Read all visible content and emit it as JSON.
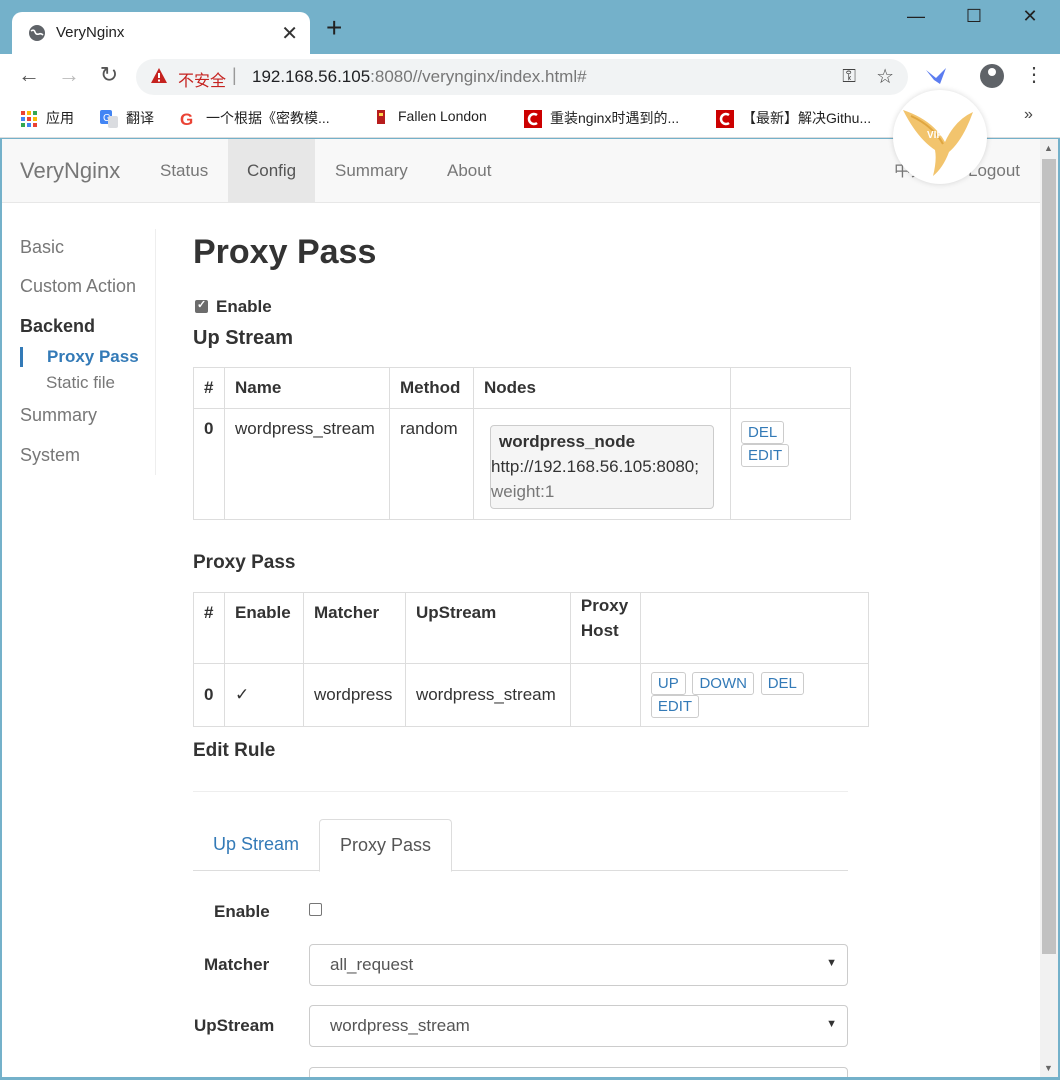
{
  "browser": {
    "tab_title": "VeryNginx",
    "new_tab": "+",
    "insecure_label": "不安全",
    "url_host": "192.168.56.105",
    "url_rest": ":8080//verynginx/index.html#",
    "bookmarks": [
      {
        "label": "应用",
        "icon": "apps-grid-icon"
      },
      {
        "label": "翻译",
        "icon": "translate-icon"
      },
      {
        "label": "一个根据《密教模...",
        "icon": "google-icon"
      },
      {
        "label": "Fallen London",
        "icon": "fallen-london-icon"
      },
      {
        "label": "重装nginx时遇到的...",
        "icon": "csdn-icon"
      },
      {
        "label": "【最新】解决Githu...",
        "icon": "csdn-icon"
      }
    ],
    "more": "»"
  },
  "navbar": {
    "brand": "VeryNginx",
    "links": [
      "Status",
      "Config",
      "Summary",
      "About"
    ],
    "active": "Config",
    "lang": "中文",
    "logout": "Logout"
  },
  "sidebar": {
    "items": [
      "Basic",
      "Custom Action",
      "Backend",
      "Summary",
      "System"
    ],
    "sub": [
      "Proxy Pass",
      "Static file"
    ]
  },
  "main": {
    "title": "Proxy Pass",
    "enable_label": "Enable",
    "upstream_heading": "Up Stream",
    "upstream_table": {
      "headers": [
        "#",
        "Name",
        "Method",
        "Nodes",
        ""
      ],
      "rows": [
        {
          "index": "0",
          "name": "wordpress_stream",
          "method": "random",
          "node_name": "wordpress_node",
          "node_url": "http://192.168.56.105:8080;",
          "node_weight": "weight:1",
          "actions": [
            "DEL",
            "EDIT"
          ]
        }
      ]
    },
    "proxypass_heading": "Proxy Pass",
    "proxypass_table": {
      "headers": [
        "#",
        "Enable",
        "Matcher",
        "UpStream",
        "Proxy Host",
        ""
      ],
      "rows": [
        {
          "index": "0",
          "enable": "✓",
          "matcher": "wordpress",
          "upstream": "wordpress_stream",
          "proxy_host": "",
          "actions": [
            "UP",
            "DOWN",
            "DEL",
            "EDIT"
          ]
        }
      ]
    },
    "edit_heading": "Edit Rule",
    "tabs": [
      "Up Stream",
      "Proxy Pass"
    ],
    "active_tab": "Proxy Pass",
    "form": {
      "enable_label": "Enable",
      "matcher_label": "Matcher",
      "matcher_value": "all_request",
      "upstream_label": "UpStream",
      "upstream_value": "wordpress_stream",
      "caret": "▼"
    }
  },
  "colors": {
    "chrome": "#74b1ca",
    "link": "#337ab7",
    "navbar_bg": "#f8f8f8"
  }
}
